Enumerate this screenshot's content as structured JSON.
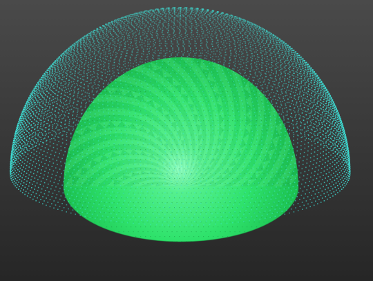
{
  "viewport": {
    "background_top": "#4a4a4a",
    "background_bottom": "#262626"
  },
  "outer_shell": {
    "render_mode": "point-cloud",
    "point_color": "#3fe6dc",
    "shape": "hemisphere"
  },
  "inner_mesh": {
    "render_mode": "shaded-surface",
    "base_color": "#22d95a",
    "highlight_color": "#7dffb4",
    "shape": "hemisphere"
  }
}
